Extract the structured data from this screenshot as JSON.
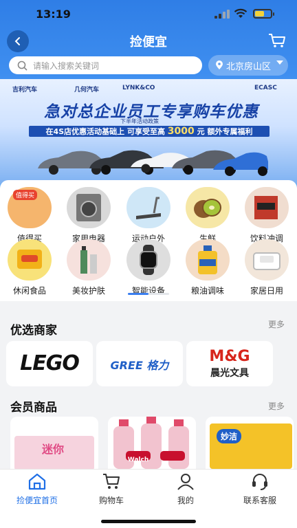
{
  "status_bar": {
    "time": "13:19"
  },
  "header": {
    "title": "捡便宜"
  },
  "search": {
    "placeholder": "请输入搜索关键词"
  },
  "location": {
    "label": "北京房山区"
  },
  "banner": {
    "brands": [
      "吉利汽车",
      "几何汽车",
      "LYNK&CO",
      "ECASC"
    ],
    "headline": "急对总企业员工专享购车优惠",
    "tag": "下半年活动政策",
    "line_prefix": "在4S店优惠活动基础上 可享受至高",
    "line_amount": "3000",
    "line_suffix": "元 额外专属福利"
  },
  "categories": [
    {
      "label": "值得买",
      "badge": "值得买",
      "color": "#f5b56d"
    },
    {
      "label": "家用电器",
      "color": "#d9d9d9"
    },
    {
      "label": "运动户外",
      "color": "#cfe7f7"
    },
    {
      "label": "生鲜",
      "color": "#f6e7a6"
    },
    {
      "label": "饮料冲调",
      "color": "#f0ddd0"
    },
    {
      "label": "休闲食品",
      "color": "#f8e27a"
    },
    {
      "label": "美妆护肤",
      "color": "#f6e1dd"
    },
    {
      "label": "智能设备",
      "color": "#dedede"
    },
    {
      "label": "粮油调味",
      "color": "#f4dcc6"
    },
    {
      "label": "家居日用",
      "color": "#f2e6da"
    }
  ],
  "merchants": {
    "title": "优选商家",
    "more": "更多",
    "items": [
      {
        "logo_text": "LEGO"
      },
      {
        "logo_text": "GREE 格力"
      },
      {
        "logo_text": "M&G",
        "logo_sub": "晨光文具"
      }
    ]
  },
  "members": {
    "title": "会员商品",
    "more": "更多",
    "items": [
      {
        "text": "迷你"
      },
      {
        "text": "Walch"
      },
      {
        "text": "妙洁"
      }
    ]
  },
  "tabbar": {
    "items": [
      {
        "label": "捡便宜首页",
        "icon": "home-icon",
        "active": true
      },
      {
        "label": "购物车",
        "icon": "cart-icon"
      },
      {
        "label": "我的",
        "icon": "user-icon"
      },
      {
        "label": "联系客服",
        "icon": "headset-icon"
      }
    ]
  },
  "colors": {
    "accent": "#1f6fe6",
    "hero": "#3f8ff0"
  }
}
